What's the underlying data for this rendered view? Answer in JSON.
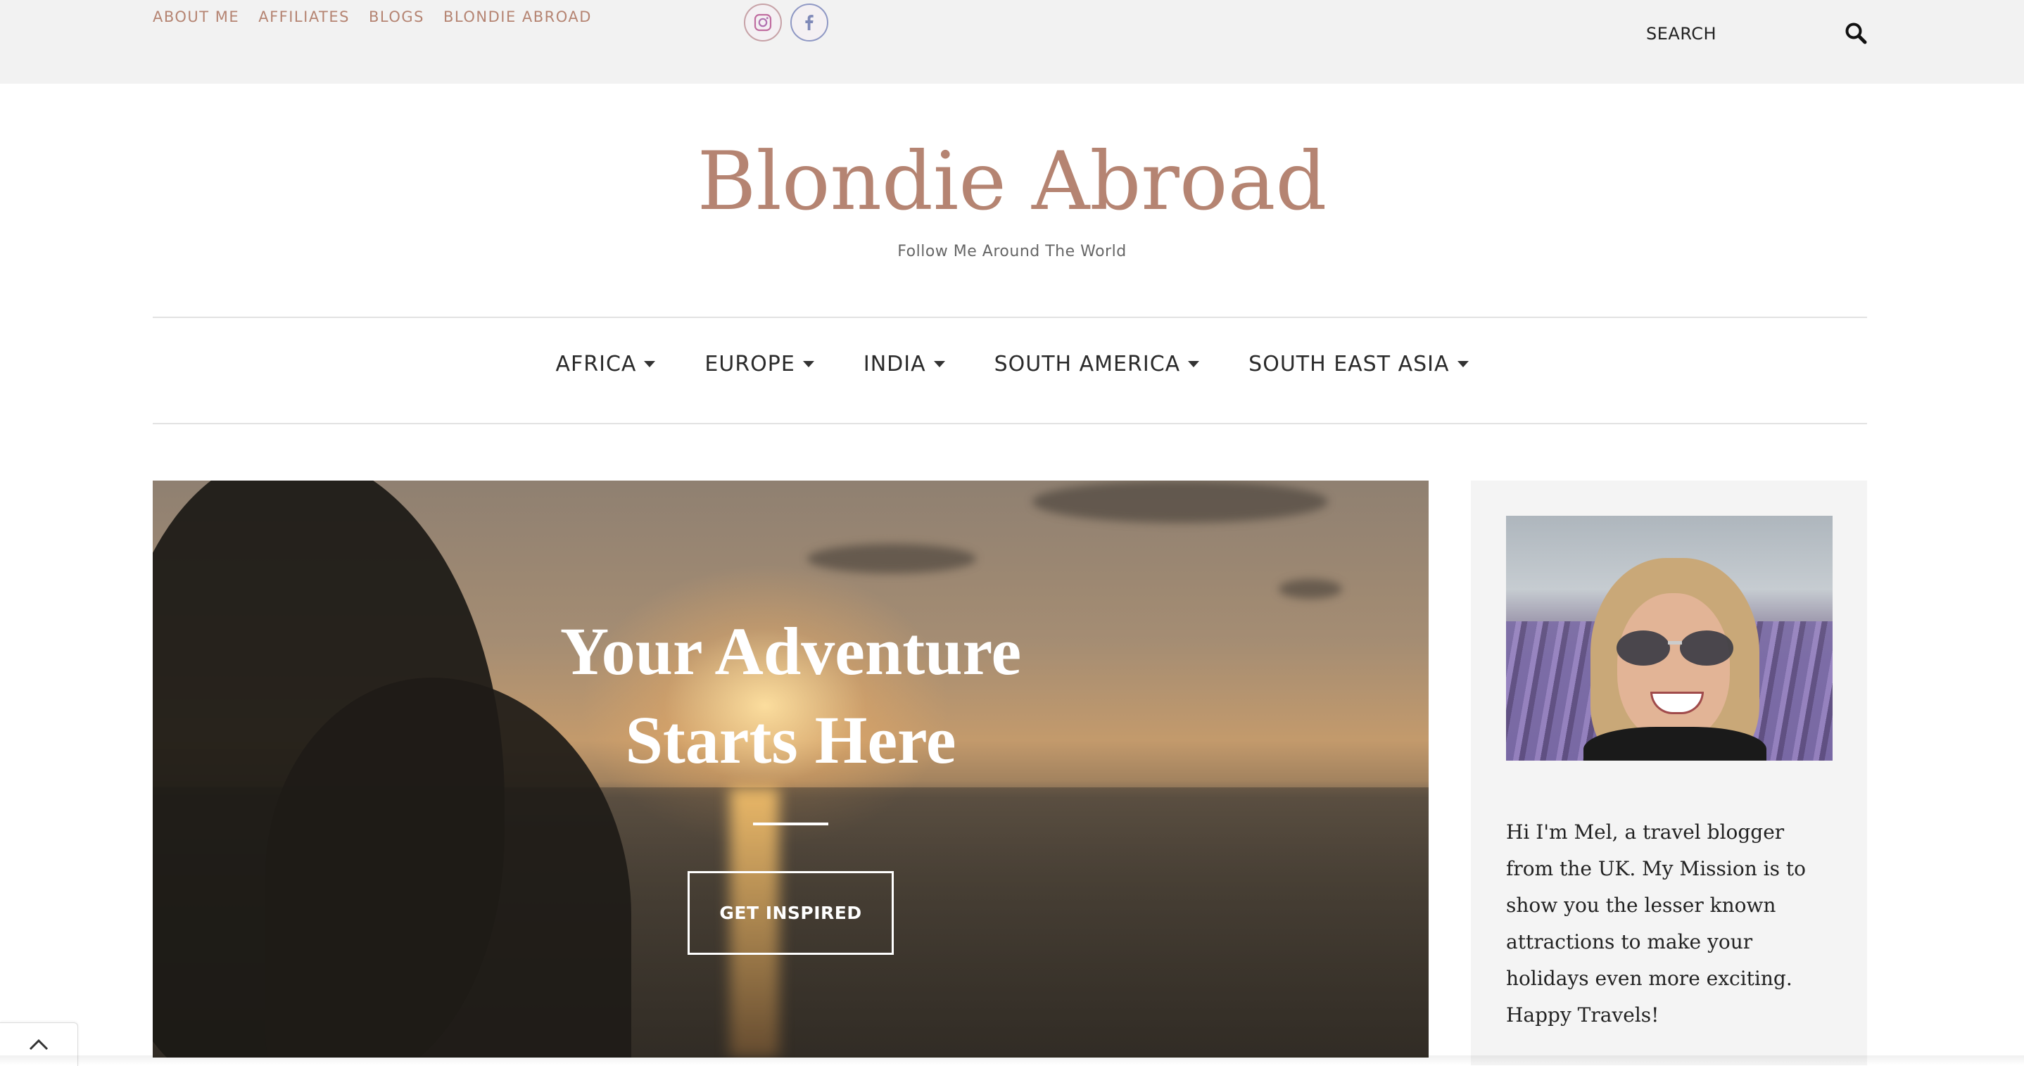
{
  "topbar": {
    "links": [
      "ABOUT ME",
      "AFFILIATES",
      "BLOGS",
      "BLONDIE ABROAD"
    ],
    "social": [
      {
        "icon": "instagram-icon"
      },
      {
        "icon": "facebook-icon"
      }
    ],
    "search": {
      "label": "SEARCH",
      "icon": "search-icon"
    }
  },
  "header": {
    "title": "Blondie Abroad",
    "tagline": "Follow Me Around The World"
  },
  "mainnav": {
    "items": [
      {
        "label": "AFRICA",
        "icon": "caret-down-icon"
      },
      {
        "label": "EUROPE",
        "icon": "caret-down-icon"
      },
      {
        "label": "INDIA",
        "icon": "caret-down-icon"
      },
      {
        "label": "SOUTH AMERICA",
        "icon": "caret-down-icon"
      },
      {
        "label": "SOUTH EAST ASIA",
        "icon": "caret-down-icon"
      }
    ]
  },
  "hero": {
    "title_line1": "Your Adventure",
    "title_line2": "Starts Here",
    "button": "GET INSPIRED"
  },
  "sidebar": {
    "bio": "Hi I'm Mel, a travel blogger from the UK. My Mission is to show you the lesser known attractions to make your holidays even more exciting. Happy Travels!"
  },
  "colors": {
    "accent": "#b58472",
    "topbar_bg": "#f2f2f2",
    "sidebar_bg": "#f4f4f4"
  },
  "back_to_top": {
    "icon": "chevron-up-icon"
  }
}
